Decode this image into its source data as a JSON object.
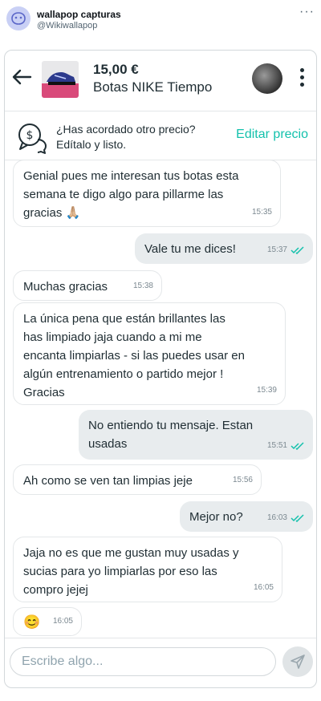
{
  "post": {
    "author_name": "wallapop capturas",
    "author_handle": "@Wikiwallapop",
    "more_icon": "ellipsis-icon"
  },
  "chat": {
    "product": {
      "price": "15,00 €",
      "title": "Botas NIKE Tiempo"
    },
    "offer_bar": {
      "line1": "¿Has acordado otro precio?",
      "line2": "Edítalo y listo.",
      "edit_label": "Editar precio"
    },
    "messages": [
      {
        "direction": "in",
        "text": "Genial pues me interesan tus botas esta\nsemana te digo algo para pillarme las\ngracias 🙏🏼",
        "time": "15:35"
      },
      {
        "direction": "out",
        "text": "Vale tu me dices!",
        "time": "15:37"
      },
      {
        "direction": "in",
        "text": "Muchas gracias",
        "time": "15:38"
      },
      {
        "direction": "in",
        "text": "La única pena que están brillantes las\nhas limpiado jaja cuando a mi me\nencanta limpiarlas - si las puedes usar en\nalgún entrenamiento o partido mejor !\nGracias",
        "time": "15:39"
      },
      {
        "direction": "out",
        "text": "No entiendo tu mensaje. Estan\nusadas",
        "time": "15:51"
      },
      {
        "direction": "in",
        "text": "Ah como se ven tan limpias jeje",
        "time": "15:56"
      },
      {
        "direction": "out",
        "text": "Mejor no?",
        "time": "16:03"
      },
      {
        "direction": "in",
        "text": "Jaja no es que me gustan muy usadas y\nsucias para yo limpiarlas por eso las\ncompro jejej",
        "time": "16:05"
      },
      {
        "direction": "in",
        "text": "😊",
        "time": "16:05"
      }
    ],
    "composer": {
      "placeholder": "Escribe algo..."
    }
  },
  "colors": {
    "accent": "#13c1ac",
    "read_check": "#13c1ac",
    "outgoing_bubble": "#e8ecee",
    "incoming_border": "#e4e7e9"
  }
}
